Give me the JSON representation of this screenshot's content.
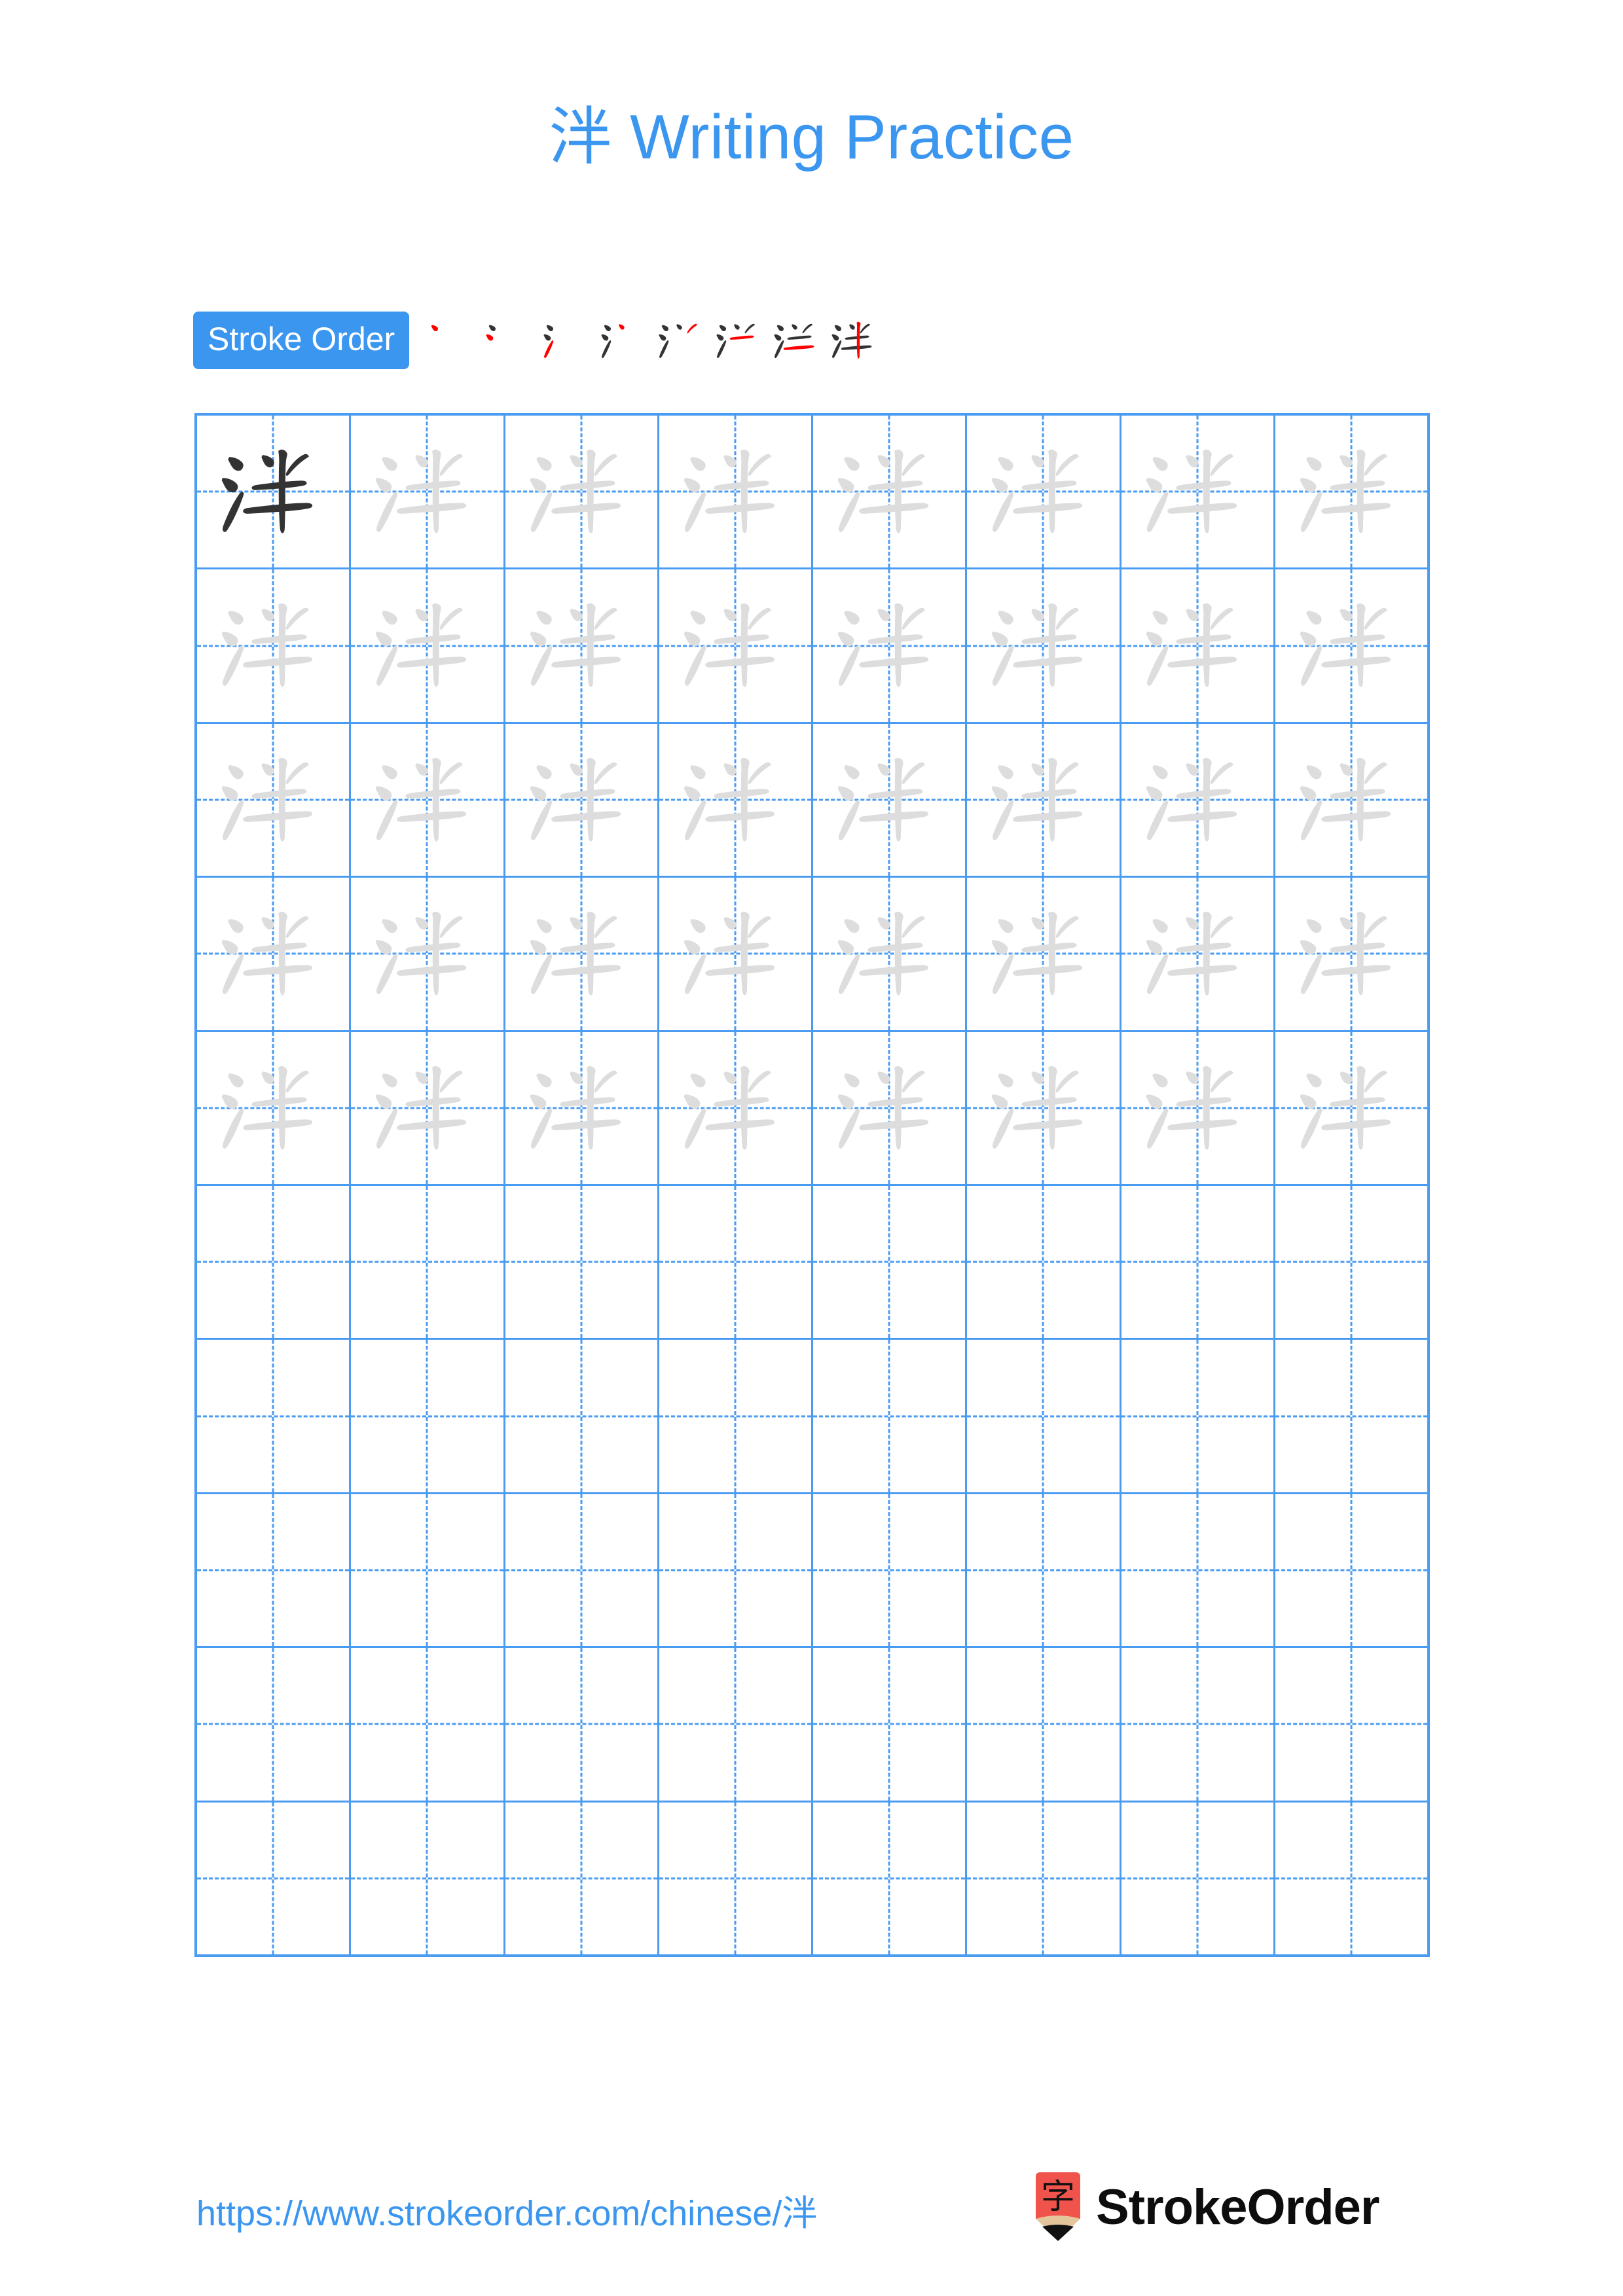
{
  "character": "泮",
  "title": {
    "character": "泮",
    "suffix": " Writing Practice",
    "full": "泮 Writing Practice",
    "color": "#3B96F0"
  },
  "stroke_order": {
    "label": "Stroke Order",
    "badge_bg": "#3B96F0",
    "badge_text_color": "#FFFFFF",
    "stroke_count": 8,
    "new_stroke_color": "#FF0000",
    "done_stroke_color": "#333333",
    "steps": [
      {
        "index": 1,
        "strokes_shown": 1,
        "new_stroke": 1,
        "description": "dot (top-left of water radical)"
      },
      {
        "index": 2,
        "strokes_shown": 2,
        "new_stroke": 2,
        "description": "second dot of water radical"
      },
      {
        "index": 3,
        "strokes_shown": 3,
        "new_stroke": 3,
        "description": "rising stroke completing 氵"
      },
      {
        "index": 4,
        "strokes_shown": 4,
        "new_stroke": 4,
        "description": "left dot of 半 top"
      },
      {
        "index": 5,
        "strokes_shown": 5,
        "new_stroke": 5,
        "description": "right dot of 半 top"
      },
      {
        "index": 6,
        "strokes_shown": 6,
        "new_stroke": 6,
        "description": "upper horizontal of 半"
      },
      {
        "index": 7,
        "strokes_shown": 7,
        "new_stroke": 7,
        "description": "lower horizontal of 半"
      },
      {
        "index": 8,
        "strokes_shown": 8,
        "new_stroke": 8,
        "description": "central vertical of 半"
      }
    ]
  },
  "grid": {
    "rows": 10,
    "columns": 8,
    "line_color": "#4A9BF2",
    "guide_style": "dashed-cross",
    "model_char_color": "#333333",
    "trace_char_color": "#DDDDDD",
    "row_fill": [
      {
        "row": 1,
        "cells": [
          "model",
          "trace",
          "trace",
          "trace",
          "trace",
          "trace",
          "trace",
          "trace"
        ]
      },
      {
        "row": 2,
        "cells": [
          "trace",
          "trace",
          "trace",
          "trace",
          "trace",
          "trace",
          "trace",
          "trace"
        ]
      },
      {
        "row": 3,
        "cells": [
          "trace",
          "trace",
          "trace",
          "trace",
          "trace",
          "trace",
          "trace",
          "trace"
        ]
      },
      {
        "row": 4,
        "cells": [
          "trace",
          "trace",
          "trace",
          "trace",
          "trace",
          "trace",
          "trace",
          "trace"
        ]
      },
      {
        "row": 5,
        "cells": [
          "trace",
          "trace",
          "trace",
          "trace",
          "trace",
          "trace",
          "trace",
          "trace"
        ]
      },
      {
        "row": 6,
        "cells": [
          "empty",
          "empty",
          "empty",
          "empty",
          "empty",
          "empty",
          "empty",
          "empty"
        ]
      },
      {
        "row": 7,
        "cells": [
          "empty",
          "empty",
          "empty",
          "empty",
          "empty",
          "empty",
          "empty",
          "empty"
        ]
      },
      {
        "row": 8,
        "cells": [
          "empty",
          "empty",
          "empty",
          "empty",
          "empty",
          "empty",
          "empty",
          "empty"
        ]
      },
      {
        "row": 9,
        "cells": [
          "empty",
          "empty",
          "empty",
          "empty",
          "empty",
          "empty",
          "empty",
          "empty"
        ]
      },
      {
        "row": 10,
        "cells": [
          "empty",
          "empty",
          "empty",
          "empty",
          "empty",
          "empty",
          "empty",
          "empty"
        ]
      }
    ]
  },
  "footer": {
    "url": "https://www.strokeorder.com/chinese/泮",
    "url_color": "#3B96F0",
    "brand_name": "StrokeOrder",
    "brand_mark_character": "字",
    "brand_mark_body_color": "#F0534C",
    "brand_mark_tip_color": "#E3C49B",
    "brand_mark_point_color": "#111111",
    "brand_text_color": "#0D0D0D"
  }
}
